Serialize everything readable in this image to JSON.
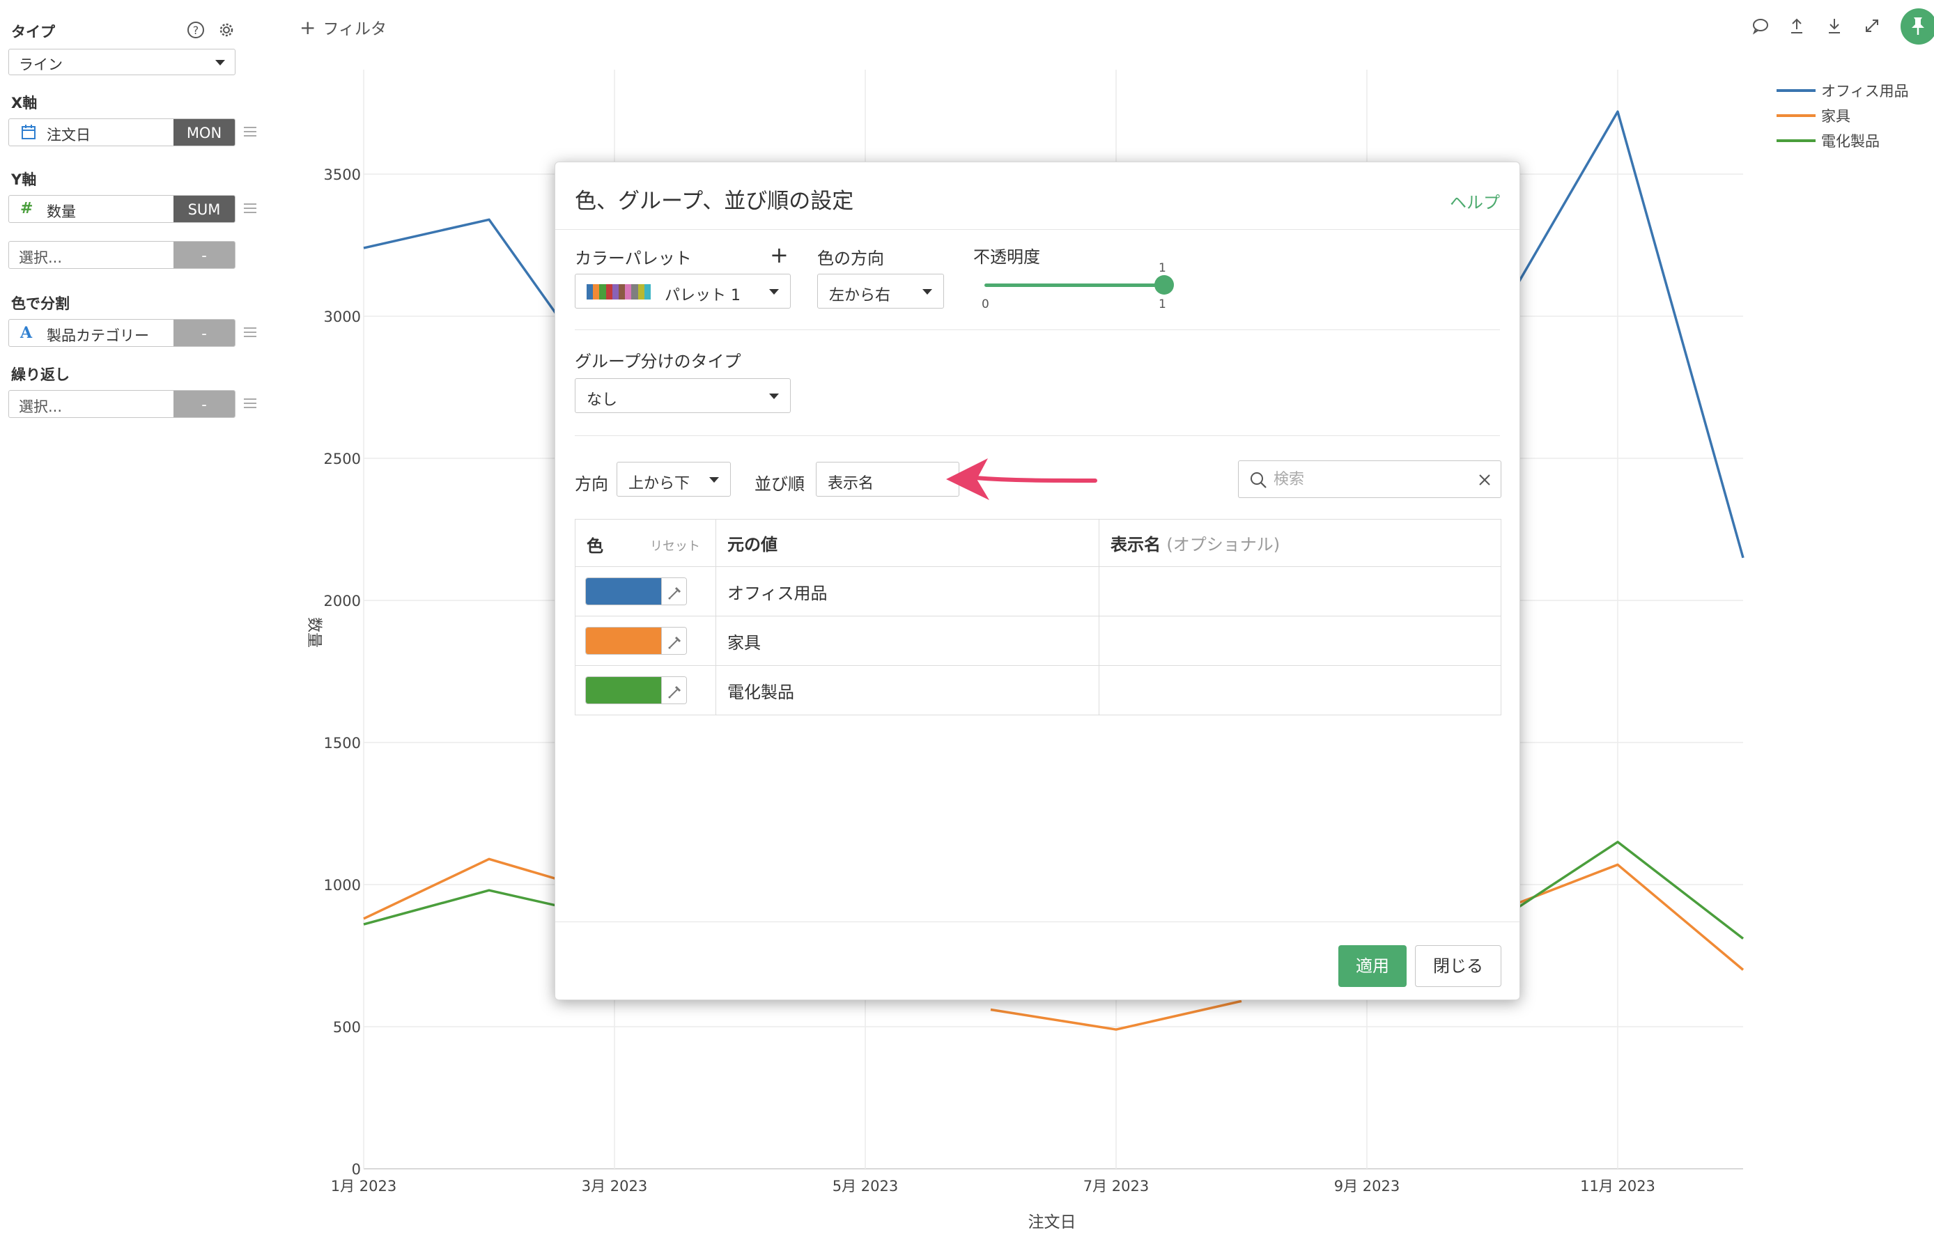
{
  "sidebar": {
    "type_label": "タイプ",
    "type_value": "ライン",
    "x_axis_label": "X軸",
    "x_field": "注文日",
    "x_agg": "MON",
    "y_axis_label": "Y軸",
    "y_field": "数量",
    "y_agg": "SUM",
    "y2_placeholder": "選択...",
    "y2_agg": "-",
    "color_label": "色で分割",
    "color_field": "製品カテゴリー",
    "color_agg": "-",
    "repeat_label": "繰り返し",
    "repeat_placeholder": "選択...",
    "repeat_agg": "-"
  },
  "topbar": {
    "filter_label": "フィルタ"
  },
  "icons": {
    "help": "help-circle-icon",
    "settings": "gear-icon",
    "calendar": "calendar-icon",
    "numeric": "hash-icon",
    "text": "text-a-icon",
    "comment": "comment-icon",
    "upload": "upload-icon",
    "download": "download-icon",
    "expand": "expand-icon",
    "pin": "pin-icon",
    "search": "search-icon",
    "clear": "close-icon",
    "eyedropper": "eyedropper-icon"
  },
  "colors": {
    "accent": "#4caa6e",
    "office": "#3a75b0",
    "furniture": "#f08a35",
    "electronics": "#4a9e3c",
    "arrow": "#e8416a"
  },
  "chart_data": {
    "type": "line",
    "xlabel": "注文日",
    "ylabel": "数量",
    "ylim": [
      0,
      3500
    ],
    "yticks": [
      0,
      500,
      1000,
      1500,
      2000,
      2500,
      3000,
      3500
    ],
    "x": [
      "2023-01",
      "2023-02",
      "2023-03",
      "2023-04",
      "2023-05",
      "2023-06",
      "2023-07",
      "2023-08",
      "2023-09",
      "2023-10",
      "2023-11",
      "2023-12"
    ],
    "xtick_labels": [
      "1月 2023",
      "3月 2023",
      "5月 2023",
      "7月 2023",
      "9月 2023",
      "11月 2023"
    ],
    "grid": true,
    "legend_position": "top-right",
    "series": [
      {
        "name": "オフィス用品",
        "color": "#3a75b0",
        "values": [
          3240,
          3340,
          2720,
          null,
          null,
          null,
          null,
          null,
          null,
          2960,
          3720,
          2150
        ]
      },
      {
        "name": "家具",
        "color": "#f08a35",
        "values": [
          880,
          1090,
          960,
          null,
          null,
          560,
          490,
          590,
          null,
          900,
          1070,
          700
        ]
      },
      {
        "name": "電化製品",
        "color": "#4a9e3c",
        "values": [
          860,
          980,
          880,
          null,
          null,
          null,
          null,
          null,
          null,
          860,
          1150,
          810
        ]
      }
    ]
  },
  "modal": {
    "title": "色、グループ、並び順の設定",
    "help_link": "ヘルプ",
    "palette_label": "カラーパレット",
    "palette_value": "パレット 1",
    "palette_add": "+",
    "direction_label": "色の方向",
    "direction_value": "左から右",
    "opacity_label": "不透明度",
    "opacity_value": 1,
    "opacity_min": "0",
    "opacity_max": "1",
    "opacity_current": "1",
    "group_type_label": "グループ分けのタイプ",
    "group_type_value": "なし",
    "order_direction_label": "方向",
    "order_direction_value": "上から下",
    "sort_label": "並び順",
    "sort_value": "表示名",
    "search_placeholder": "検索",
    "table": {
      "col_color": "色",
      "reset": "リセット",
      "col_original": "元の値",
      "col_display": "表示名",
      "col_display_hint": "(オプショナル)",
      "rows": [
        {
          "color": "#3a75b0",
          "original": "オフィス用品",
          "display": ""
        },
        {
          "color": "#f08a35",
          "original": "家具",
          "display": ""
        },
        {
          "color": "#4a9e3c",
          "original": "電化製品",
          "display": ""
        }
      ]
    },
    "apply": "適用",
    "close": "閉じる"
  }
}
